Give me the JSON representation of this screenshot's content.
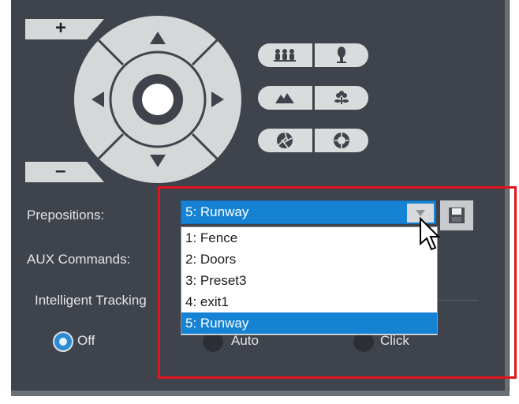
{
  "ptz": {
    "zoom_in_label": "+",
    "zoom_out_label": "–",
    "pad_icons": [
      "up-arrow-icon",
      "right-arrow-icon",
      "down-arrow-icon",
      "left-arrow-icon",
      "center-home-icon"
    ]
  },
  "view_buttons": {
    "icons": [
      "group-people-icon",
      "single-person-icon",
      "landscape-icon",
      "flower-macro-icon",
      "aperture-open-icon",
      "aperture-close-icon"
    ]
  },
  "prepositions": {
    "label": "Prepositions:",
    "selected": "5: Runway",
    "options": [
      "1: Fence",
      "2: Doors",
      "3: Preset3",
      "4: exit1",
      "5: Runway"
    ],
    "save_icon": "save-icon"
  },
  "aux": {
    "label": "AUX Commands:"
  },
  "tracking": {
    "label": "Intelligent Tracking",
    "options": [
      {
        "label": "Off",
        "selected": true
      },
      {
        "label": "Auto",
        "selected": false
      },
      {
        "label": "Click",
        "selected": false
      }
    ]
  },
  "colors": {
    "panel_bg": "#3f434b",
    "accent": "#1682d4",
    "highlight": "#e3141b"
  }
}
